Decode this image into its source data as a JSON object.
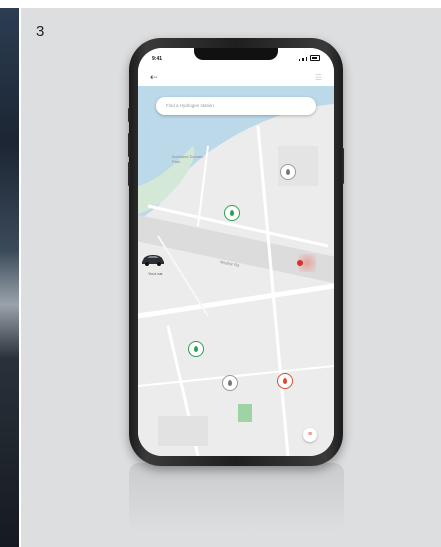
{
  "card": {
    "number": "3"
  },
  "phone": {
    "status_bar": {
      "time": "9:41"
    },
    "app_bar": {
      "back_icon": "back-arrow-icon",
      "menu_icon": "menu-icon"
    },
    "search": {
      "placeholder": "Find a Hydrogen station"
    },
    "map": {
      "labels": [
        {
          "text": "Auckland Domain Park"
        },
        {
          "text": "Mayfair Rd"
        }
      ],
      "vehicle": {
        "label": "Your car"
      },
      "stations": [
        {
          "status": "green"
        },
        {
          "status": "grey"
        },
        {
          "status": "green"
        },
        {
          "status": "grey"
        },
        {
          "status": "red"
        }
      ],
      "fab_icon": "list-icon"
    }
  },
  "colors": {
    "available": "#2e9e52",
    "unavailable": "#e04a30",
    "inactive": "#9a9a9a",
    "water": "#bcd9ea",
    "park": "#cfe6d3"
  }
}
